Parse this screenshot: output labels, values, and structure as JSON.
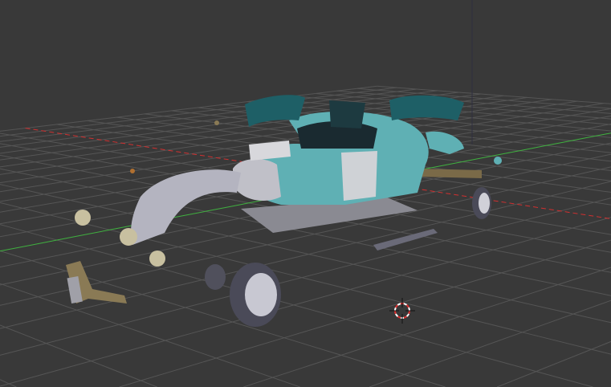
{
  "viewport": {
    "background": "#393939",
    "grid_color": "#555555",
    "x_axis_color": "#d03030",
    "y_axis_color": "#40b040",
    "z_axis_color": "#3a3a5a"
  },
  "model": {
    "body_color": "#5fb0b4",
    "panel_dark_color": "#1e5f66",
    "fender_color": "#b4b4c0",
    "chrome_color": "#8a7a55",
    "tire_color": "#4a4a58"
  },
  "cursor": {
    "ring_red": "#e03030",
    "ring_white": "#ffffff"
  }
}
